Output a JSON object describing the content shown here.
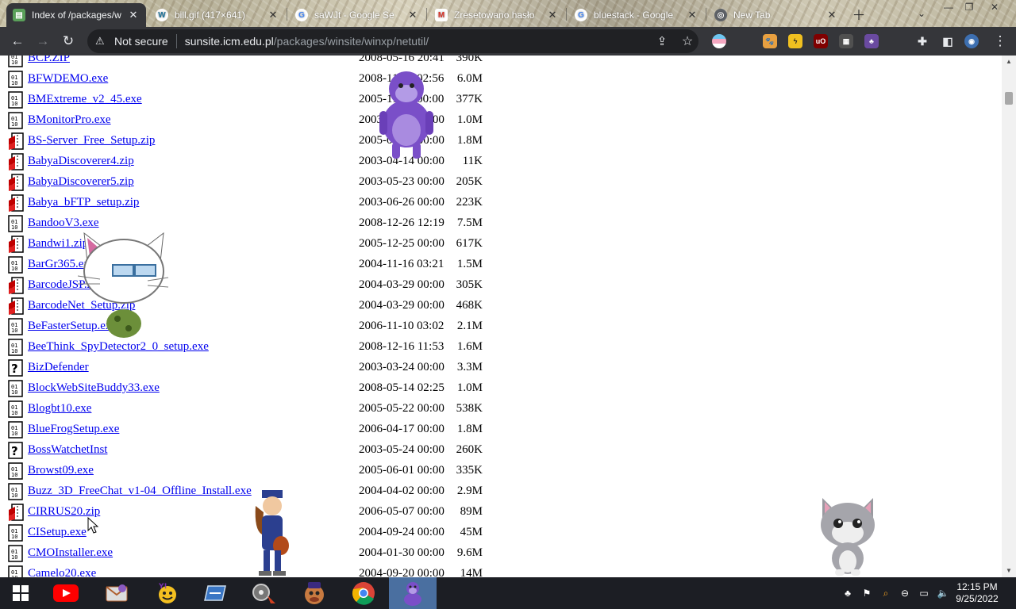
{
  "browser": {
    "tabs": [
      {
        "title": "Index of /packages/w",
        "favicon": "folder-icon",
        "active": true
      },
      {
        "title": "bill.gif (417×641)",
        "favicon": "wordpress-icon",
        "active": false
      },
      {
        "title": "saWJt - Google Se",
        "favicon": "google-icon",
        "active": false
      },
      {
        "title": "Zresetowano hasło",
        "favicon": "gmail-icon",
        "active": false
      },
      {
        "title": "bluestack - Google",
        "favicon": "google-icon",
        "active": false
      },
      {
        "title": "New Tab",
        "favicon": "chrome-icon",
        "active": false
      }
    ],
    "address": {
      "security_label": "Not secure",
      "host": "sunsite.icm.edu.pl",
      "path": "/packages/winsite/winxp/netutil/"
    }
  },
  "listing": {
    "partial_top": {
      "name": "BCP.ZIP",
      "date": "2008-05-16 20:41",
      "size": "390K"
    },
    "files": [
      {
        "name": "BFWDEMO.exe",
        "date": "2008-11-29 02:56",
        "size": "6.0M",
        "type": "exe"
      },
      {
        "name": "BMExtreme_v2_45.exe",
        "date": "2005-11-01 00:00",
        "size": "377K",
        "type": "exe"
      },
      {
        "name": "BMonitorPro.exe",
        "date": "2003-06-01 00:00",
        "size": "1.0M",
        "type": "exe"
      },
      {
        "name": "BS-Server_Free_Setup.zip",
        "date": "2005-06-12 00:00",
        "size": "1.8M",
        "type": "zip"
      },
      {
        "name": "BabyaDiscoverer4.zip",
        "date": "2003-04-14 00:00",
        "size": "11K",
        "type": "zip"
      },
      {
        "name": "BabyaDiscoverer5.zip",
        "date": "2003-05-23 00:00",
        "size": "205K",
        "type": "zip"
      },
      {
        "name": "Babya_bFTP_setup.zip",
        "date": "2003-06-26 00:00",
        "size": "223K",
        "type": "zip"
      },
      {
        "name": "BandooV3.exe",
        "date": "2008-12-26 12:19",
        "size": "7.5M",
        "type": "exe"
      },
      {
        "name": "Bandwi1.zip",
        "date": "2005-12-25 00:00",
        "size": "617K",
        "type": "zip"
      },
      {
        "name": "BarGr365.exe",
        "date": "2004-11-16 03:21",
        "size": "1.5M",
        "type": "exe"
      },
      {
        "name": "BarcodeJSP.zip",
        "date": "2004-03-29 00:00",
        "size": "305K",
        "type": "zip"
      },
      {
        "name": "BarcodeNet_Setup.zip",
        "date": "2004-03-29 00:00",
        "size": "468K",
        "type": "zip"
      },
      {
        "name": "BeFasterSetup.exe",
        "date": "2006-11-10 03:02",
        "size": "2.1M",
        "type": "exe"
      },
      {
        "name": "BeeThink_SpyDetector2_0_setup.exe",
        "date": "2008-12-16 11:53",
        "size": "1.6M",
        "type": "exe"
      },
      {
        "name": "BizDefender",
        "date": "2003-03-24 00:00",
        "size": "3.3M",
        "type": "unknown"
      },
      {
        "name": "BlockWebSiteBuddy33.exe",
        "date": "2008-05-14 02:25",
        "size": "1.0M",
        "type": "exe"
      },
      {
        "name": "Blogbt10.exe",
        "date": "2005-05-22 00:00",
        "size": "538K",
        "type": "exe"
      },
      {
        "name": "BlueFrogSetup.exe",
        "date": "2006-04-17 00:00",
        "size": "1.8M",
        "type": "exe"
      },
      {
        "name": "BossWatchetInst",
        "date": "2003-05-24 00:00",
        "size": "260K",
        "type": "unknown"
      },
      {
        "name": "Browst09.exe",
        "date": "2005-06-01 00:00",
        "size": "335K",
        "type": "exe"
      },
      {
        "name": "Buzz_3D_FreeChat_v1-04_Offline_Install.exe",
        "date": "2004-04-02 00:00",
        "size": "2.9M",
        "type": "exe"
      },
      {
        "name": "CIRRUS20.zip",
        "date": "2006-05-07 00:00",
        "size": "89M",
        "type": "zip"
      },
      {
        "name": "CISetup.exe",
        "date": "2004-09-24 00:00",
        "size": "45M",
        "type": "exe"
      },
      {
        "name": "CMOInstaller.exe",
        "date": "2004-01-30 00:00",
        "size": "9.6M",
        "type": "exe"
      },
      {
        "name": "Camelo20.exe",
        "date": "2004-09-20 00:00",
        "size": "14M",
        "type": "exe"
      }
    ]
  },
  "taskbar": {
    "apps": [
      "windows-start-icon",
      "youtube-icon",
      "mail-app-icon",
      "yahoo-messenger-icon",
      "scanner-app-icon",
      "media-app-icon",
      "bonzi-agent-icon",
      "chrome-icon",
      "bonzibuddy-icon"
    ],
    "clock_time": "12:15 PM",
    "clock_date": "9/25/2022"
  },
  "colors": {
    "link": "#0000ee",
    "toolbar": "#35363a",
    "taskbar": "#1c1e24"
  }
}
